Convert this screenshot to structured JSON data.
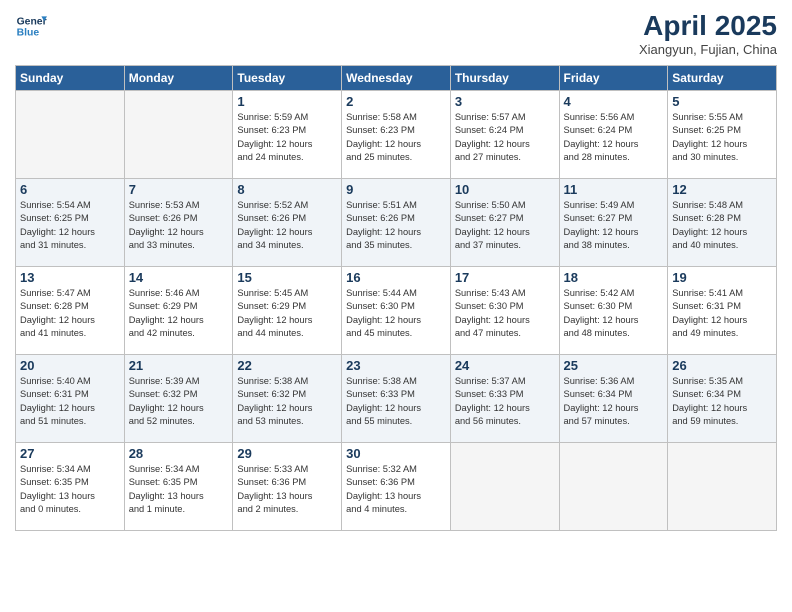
{
  "logo": {
    "line1": "General",
    "line2": "Blue"
  },
  "title": "April 2025",
  "subtitle": "Xiangyun, Fujian, China",
  "weekdays": [
    "Sunday",
    "Monday",
    "Tuesday",
    "Wednesday",
    "Thursday",
    "Friday",
    "Saturday"
  ],
  "weeks": [
    [
      {
        "day": "",
        "info": ""
      },
      {
        "day": "",
        "info": ""
      },
      {
        "day": "1",
        "info": "Sunrise: 5:59 AM\nSunset: 6:23 PM\nDaylight: 12 hours\nand 24 minutes."
      },
      {
        "day": "2",
        "info": "Sunrise: 5:58 AM\nSunset: 6:23 PM\nDaylight: 12 hours\nand 25 minutes."
      },
      {
        "day": "3",
        "info": "Sunrise: 5:57 AM\nSunset: 6:24 PM\nDaylight: 12 hours\nand 27 minutes."
      },
      {
        "day": "4",
        "info": "Sunrise: 5:56 AM\nSunset: 6:24 PM\nDaylight: 12 hours\nand 28 minutes."
      },
      {
        "day": "5",
        "info": "Sunrise: 5:55 AM\nSunset: 6:25 PM\nDaylight: 12 hours\nand 30 minutes."
      }
    ],
    [
      {
        "day": "6",
        "info": "Sunrise: 5:54 AM\nSunset: 6:25 PM\nDaylight: 12 hours\nand 31 minutes."
      },
      {
        "day": "7",
        "info": "Sunrise: 5:53 AM\nSunset: 6:26 PM\nDaylight: 12 hours\nand 33 minutes."
      },
      {
        "day": "8",
        "info": "Sunrise: 5:52 AM\nSunset: 6:26 PM\nDaylight: 12 hours\nand 34 minutes."
      },
      {
        "day": "9",
        "info": "Sunrise: 5:51 AM\nSunset: 6:26 PM\nDaylight: 12 hours\nand 35 minutes."
      },
      {
        "day": "10",
        "info": "Sunrise: 5:50 AM\nSunset: 6:27 PM\nDaylight: 12 hours\nand 37 minutes."
      },
      {
        "day": "11",
        "info": "Sunrise: 5:49 AM\nSunset: 6:27 PM\nDaylight: 12 hours\nand 38 minutes."
      },
      {
        "day": "12",
        "info": "Sunrise: 5:48 AM\nSunset: 6:28 PM\nDaylight: 12 hours\nand 40 minutes."
      }
    ],
    [
      {
        "day": "13",
        "info": "Sunrise: 5:47 AM\nSunset: 6:28 PM\nDaylight: 12 hours\nand 41 minutes."
      },
      {
        "day": "14",
        "info": "Sunrise: 5:46 AM\nSunset: 6:29 PM\nDaylight: 12 hours\nand 42 minutes."
      },
      {
        "day": "15",
        "info": "Sunrise: 5:45 AM\nSunset: 6:29 PM\nDaylight: 12 hours\nand 44 minutes."
      },
      {
        "day": "16",
        "info": "Sunrise: 5:44 AM\nSunset: 6:30 PM\nDaylight: 12 hours\nand 45 minutes."
      },
      {
        "day": "17",
        "info": "Sunrise: 5:43 AM\nSunset: 6:30 PM\nDaylight: 12 hours\nand 47 minutes."
      },
      {
        "day": "18",
        "info": "Sunrise: 5:42 AM\nSunset: 6:30 PM\nDaylight: 12 hours\nand 48 minutes."
      },
      {
        "day": "19",
        "info": "Sunrise: 5:41 AM\nSunset: 6:31 PM\nDaylight: 12 hours\nand 49 minutes."
      }
    ],
    [
      {
        "day": "20",
        "info": "Sunrise: 5:40 AM\nSunset: 6:31 PM\nDaylight: 12 hours\nand 51 minutes."
      },
      {
        "day": "21",
        "info": "Sunrise: 5:39 AM\nSunset: 6:32 PM\nDaylight: 12 hours\nand 52 minutes."
      },
      {
        "day": "22",
        "info": "Sunrise: 5:38 AM\nSunset: 6:32 PM\nDaylight: 12 hours\nand 53 minutes."
      },
      {
        "day": "23",
        "info": "Sunrise: 5:38 AM\nSunset: 6:33 PM\nDaylight: 12 hours\nand 55 minutes."
      },
      {
        "day": "24",
        "info": "Sunrise: 5:37 AM\nSunset: 6:33 PM\nDaylight: 12 hours\nand 56 minutes."
      },
      {
        "day": "25",
        "info": "Sunrise: 5:36 AM\nSunset: 6:34 PM\nDaylight: 12 hours\nand 57 minutes."
      },
      {
        "day": "26",
        "info": "Sunrise: 5:35 AM\nSunset: 6:34 PM\nDaylight: 12 hours\nand 59 minutes."
      }
    ],
    [
      {
        "day": "27",
        "info": "Sunrise: 5:34 AM\nSunset: 6:35 PM\nDaylight: 13 hours\nand 0 minutes."
      },
      {
        "day": "28",
        "info": "Sunrise: 5:34 AM\nSunset: 6:35 PM\nDaylight: 13 hours\nand 1 minute."
      },
      {
        "day": "29",
        "info": "Sunrise: 5:33 AM\nSunset: 6:36 PM\nDaylight: 13 hours\nand 2 minutes."
      },
      {
        "day": "30",
        "info": "Sunrise: 5:32 AM\nSunset: 6:36 PM\nDaylight: 13 hours\nand 4 minutes."
      },
      {
        "day": "",
        "info": ""
      },
      {
        "day": "",
        "info": ""
      },
      {
        "day": "",
        "info": ""
      }
    ]
  ]
}
